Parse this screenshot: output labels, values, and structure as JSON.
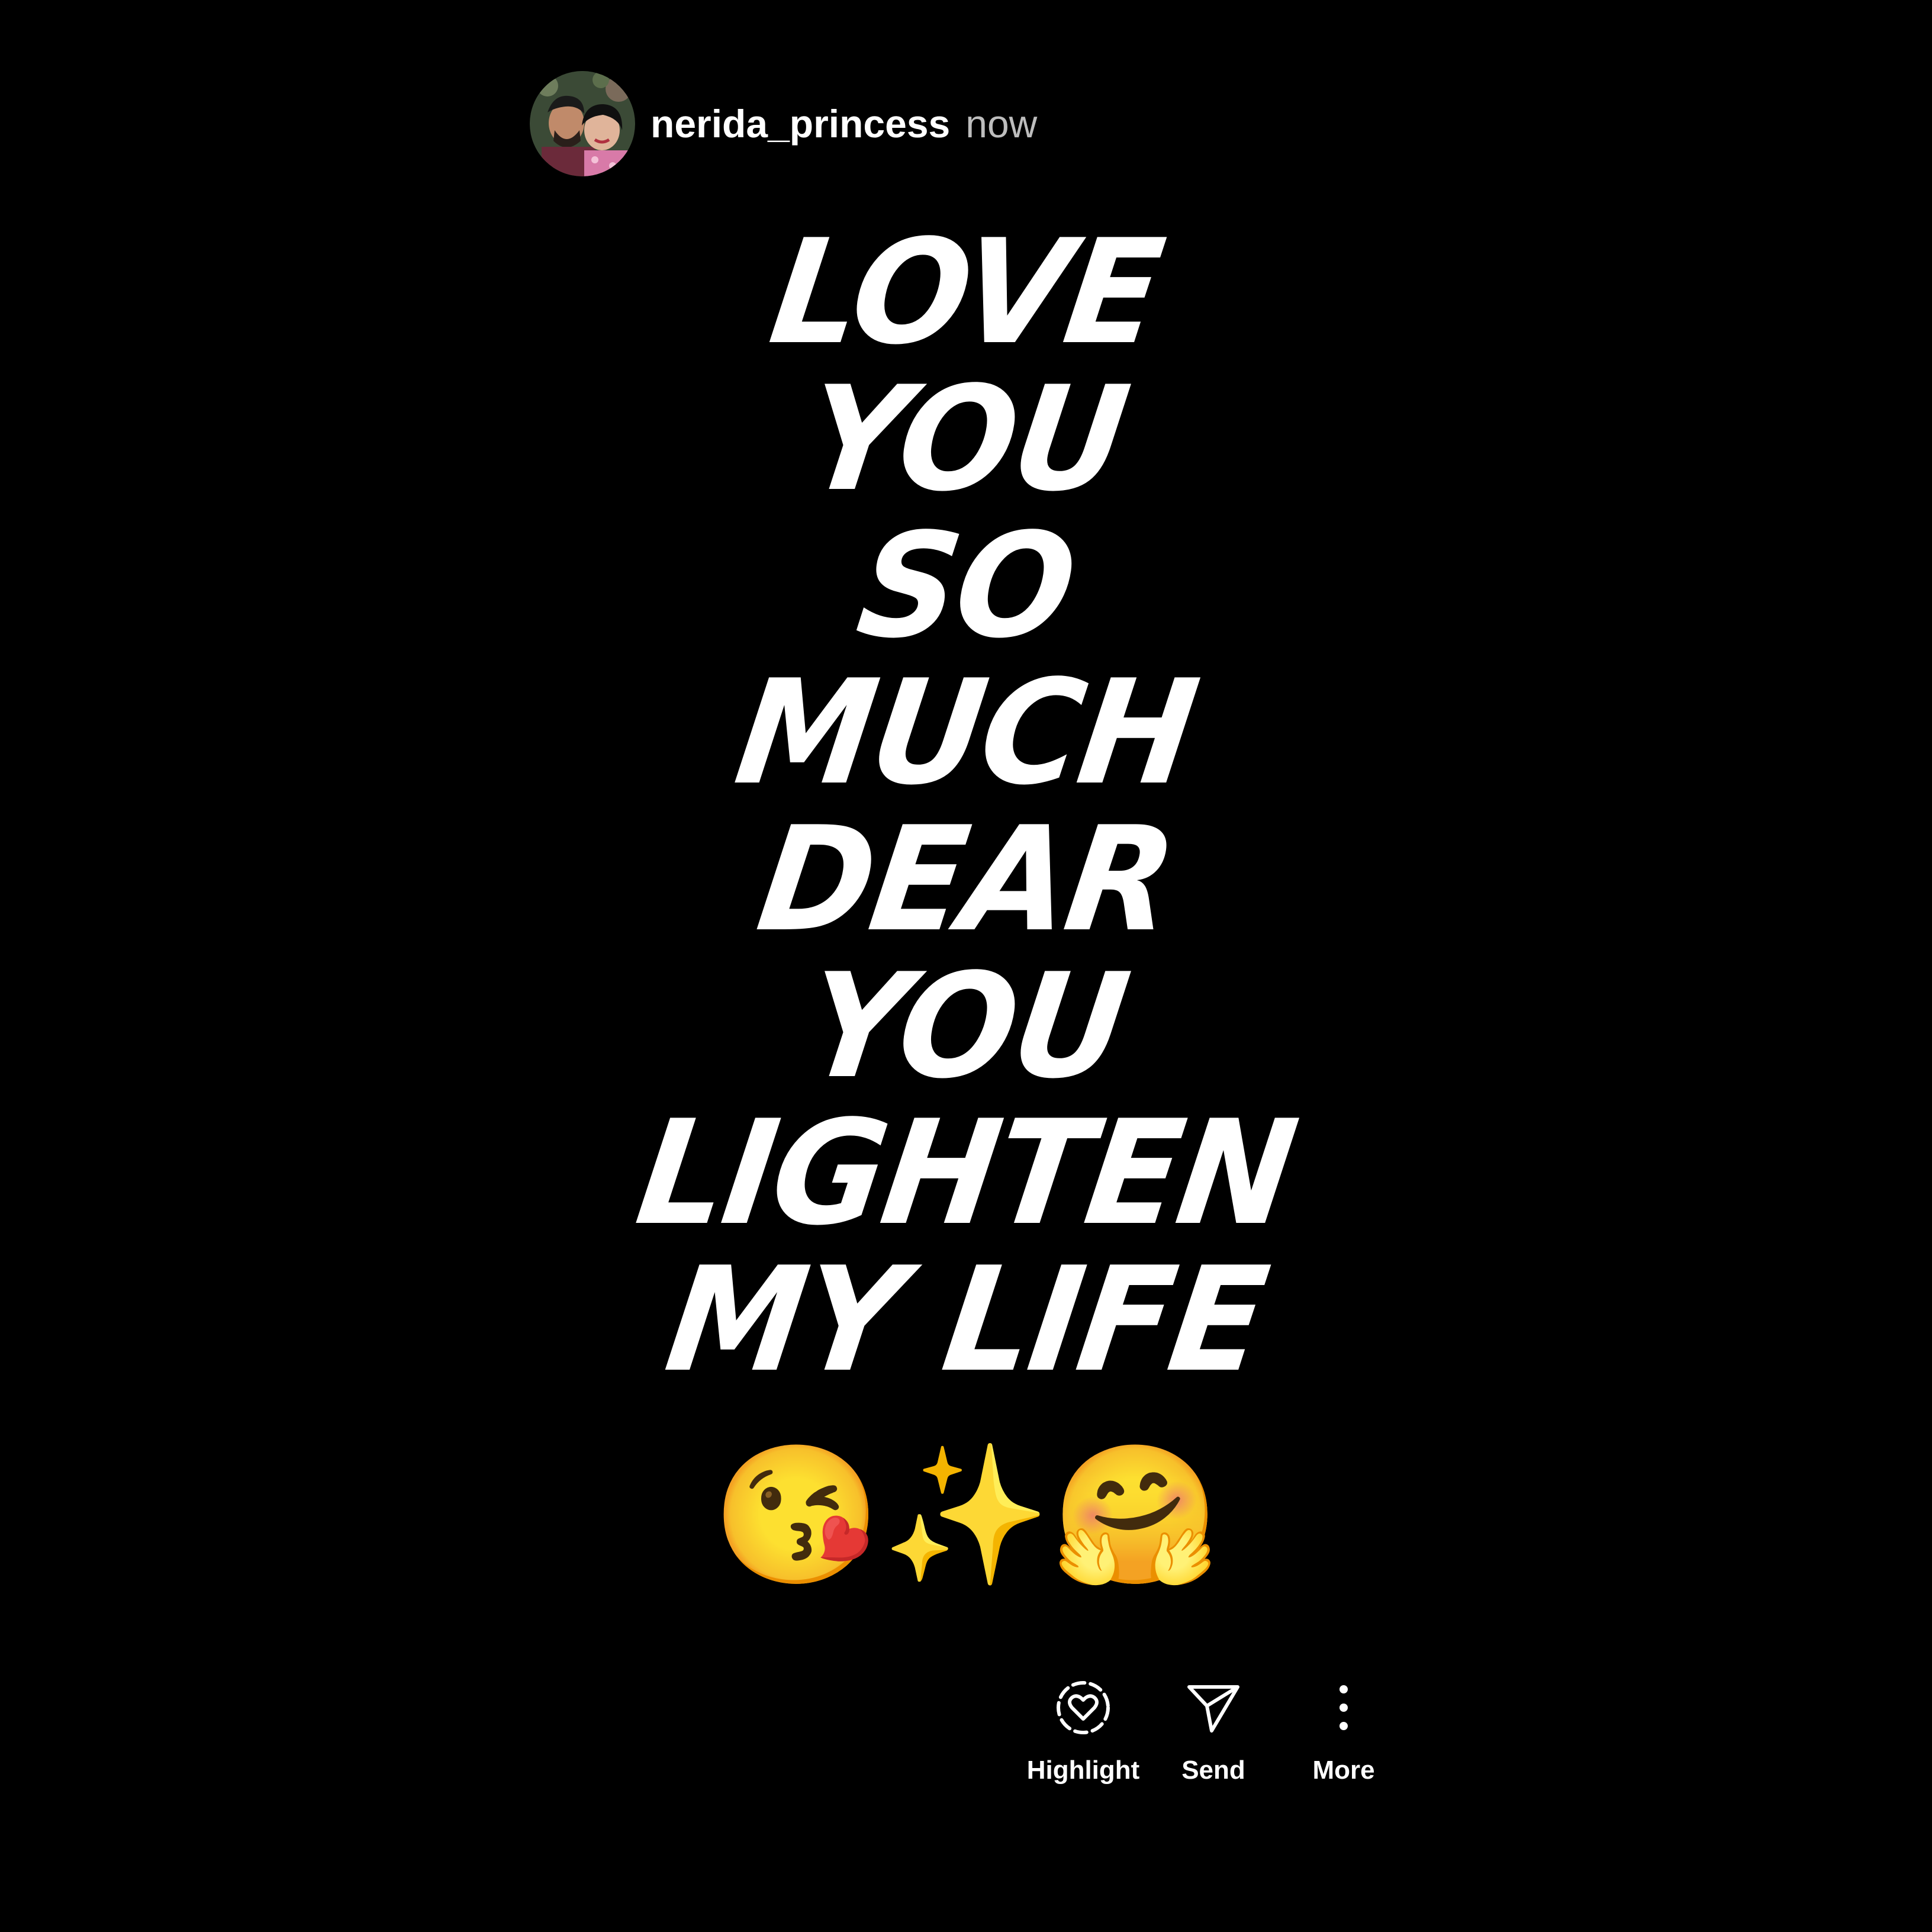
{
  "header": {
    "username": "nerida_princess",
    "timestamp": "now"
  },
  "story": {
    "lines": [
      "LOVE",
      "YOU",
      "SO",
      "MUCH",
      "DEAR",
      "YOU",
      "LIGHTEN",
      "MY LIFE"
    ],
    "emojis": "😘✨🤗"
  },
  "actions": {
    "highlight": {
      "label": "Highlight",
      "icon": "highlight-heart-icon"
    },
    "send": {
      "label": "Send",
      "icon": "send-icon"
    },
    "more": {
      "label": "More",
      "icon": "more-vertical-icon"
    }
  }
}
